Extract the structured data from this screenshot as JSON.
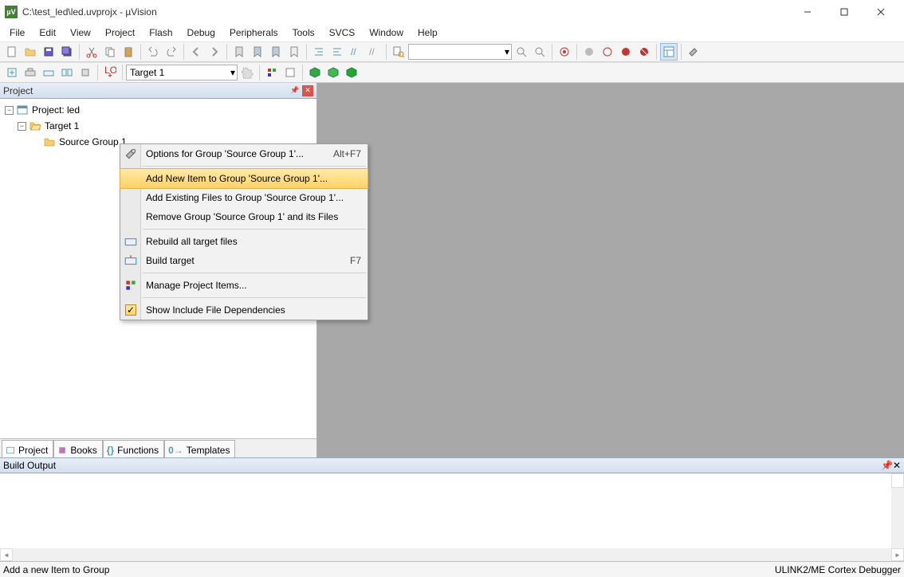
{
  "title": "C:\\test_led\\led.uvprojx - µVision",
  "menus": [
    "File",
    "Edit",
    "View",
    "Project",
    "Flash",
    "Debug",
    "Peripherals",
    "Tools",
    "SVCS",
    "Window",
    "Help"
  ],
  "toolbar2": {
    "target": "Target 1"
  },
  "projectPanel": {
    "title": "Project",
    "root": "Project: led",
    "target": "Target 1",
    "group": "Source Group 1"
  },
  "tabs": [
    {
      "label": "Project",
      "active": true
    },
    {
      "label": "Books"
    },
    {
      "label": "Functions"
    },
    {
      "label": "Templates"
    }
  ],
  "context": {
    "options": {
      "label": "Options for Group 'Source Group 1'...",
      "shortcut": "Alt+F7"
    },
    "addnew": {
      "label": "Add New  Item to Group 'Source Group 1'..."
    },
    "addexist": {
      "label": "Add Existing Files to Group 'Source Group 1'..."
    },
    "remove": {
      "label": "Remove Group 'Source Group 1' and its Files"
    },
    "rebuild": {
      "label": "Rebuild all target files"
    },
    "build": {
      "label": "Build target",
      "shortcut": "F7"
    },
    "manage": {
      "label": "Manage Project Items..."
    },
    "showinc": {
      "label": "Show Include File Dependencies"
    }
  },
  "buildOutput": {
    "title": "Build Output"
  },
  "status": {
    "left": "Add a new Item to Group",
    "right": "ULINK2/ME Cortex Debugger"
  }
}
